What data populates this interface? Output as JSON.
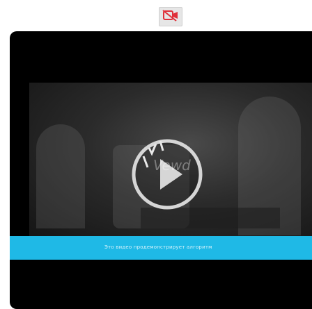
{
  "toolbar": {
    "button_icon": "camera-off-icon",
    "icon_color": "#e0303a"
  },
  "player": {
    "background": "#000000",
    "watermark_text": "Vewd",
    "play_icon": "play-icon",
    "caption": "Это видео продемонстрирует алгоритм",
    "caption_bar_color": "#1fb9e6"
  }
}
